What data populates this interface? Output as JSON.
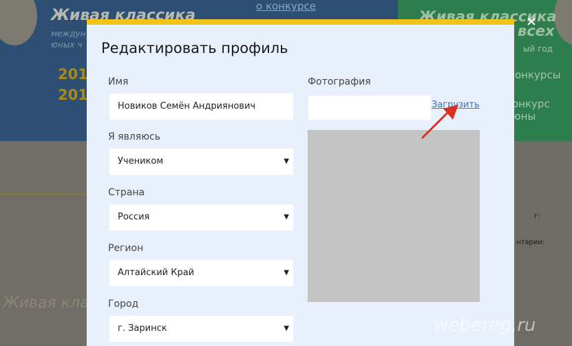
{
  "background": {
    "left_title": "Живая классика",
    "left_sub1": "междун",
    "left_sub2": "юных ч",
    "year1": "201",
    "year2": "201",
    "top_link": "о конкурсе",
    "right_title1": "Живая классика",
    "right_title2": "всех",
    "right_sub": "ый год",
    "right_link1": "онкурсы",
    "right_link2": "онкурс юны",
    "right_text1": "г:",
    "right_text2": "нтарии:",
    "script_text": "Живая клас"
  },
  "modal": {
    "title": "Редактировать профиль",
    "close": "×",
    "name": {
      "label": "Имя",
      "value": "Новиков Семён Андриянович"
    },
    "role": {
      "label": "Я являюсь",
      "value": "Учеником"
    },
    "country": {
      "label": "Страна",
      "value": "Россия"
    },
    "region": {
      "label": "Регион",
      "value": "Алтайский Край"
    },
    "city": {
      "label": "Город",
      "value": "г. Заринск"
    },
    "photo": {
      "label": "Фотография",
      "upload": "Загрузить"
    }
  },
  "icons": {
    "dropdown": "▼",
    "close": "close-icon",
    "annotation": "red-arrow"
  },
  "colors": {
    "accent": "#f2c418",
    "link": "#3b73b8",
    "arrow": "#d9311f"
  },
  "watermark": "webereg.ru"
}
